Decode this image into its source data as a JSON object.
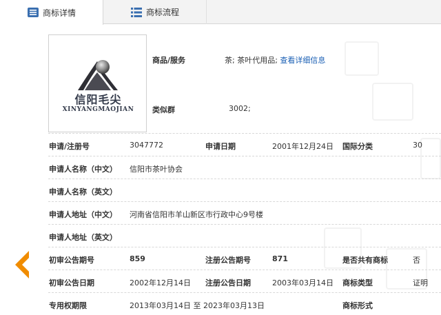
{
  "tabs": [
    {
      "label": "商标详情",
      "active": true,
      "icon": "list-icon"
    },
    {
      "label": "商标流程",
      "active": false,
      "icon": "table-icon"
    }
  ],
  "logo": {
    "text_cn": "信阳毛尖",
    "text_en": "XINYANGMAOJIAN"
  },
  "goods": {
    "label": "商品/服务",
    "value": "茶; 茶叶代用品;",
    "link": "查看详细信息"
  },
  "similar_group": {
    "label": "类似群",
    "value": "3002;"
  },
  "fields": {
    "reg_no": {
      "label": "申请/注册号",
      "value": "3047772"
    },
    "apply_date": {
      "label": "申请日期",
      "value": "2001年12月24日"
    },
    "intl_class": {
      "label": "国际分类",
      "value": "30"
    },
    "applicant_cn": {
      "label": "申请人名称（中文）",
      "value": "信阳市茶叶协会"
    },
    "applicant_en": {
      "label": "申请人名称（英文）",
      "value": ""
    },
    "address_cn": {
      "label": "申请人地址（中文）",
      "value": "河南省信阳市羊山新区市行政中心9号楼"
    },
    "address_en": {
      "label": "申请人地址（英文）",
      "value": ""
    },
    "prelim_issue": {
      "label": "初审公告期号",
      "value": "859"
    },
    "reg_issue": {
      "label": "注册公告期号",
      "value": "871"
    },
    "shared": {
      "label": "是否共有商标",
      "value": "否"
    },
    "prelim_date": {
      "label": "初审公告日期",
      "value": "2002年12月14日"
    },
    "reg_date": {
      "label": "注册公告日期",
      "value": "2003年03月14日"
    },
    "tm_type": {
      "label": "商标类型",
      "value": "证明"
    },
    "term": {
      "label": "专用权期限",
      "value": "2013年03月14日 至 2023年03月13日"
    },
    "tm_form": {
      "label": "商标形式",
      "value": ""
    }
  },
  "colors": {
    "accent": "#f08c00",
    "link": "#1a5fb4",
    "tab_icon": "#3a6fb0"
  }
}
